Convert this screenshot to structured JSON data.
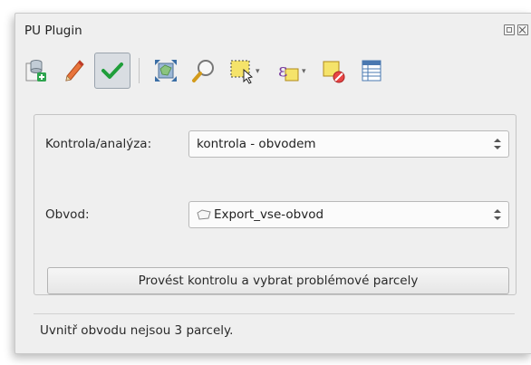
{
  "window": {
    "title": "PU Plugin"
  },
  "toolbar": {
    "tools": [
      {
        "icon": "add-database-layer-icon"
      },
      {
        "icon": "pencil-edit-icon"
      },
      {
        "icon": "checkmark-icon",
        "active": true
      },
      {
        "icon": "zoom-full-extent-icon"
      },
      {
        "icon": "zoom-magnifier-icon"
      },
      {
        "icon": "select-features-icon"
      },
      {
        "icon": "select-by-expression-icon"
      },
      {
        "icon": "deselect-features-icon"
      },
      {
        "icon": "attribute-table-icon"
      }
    ]
  },
  "form": {
    "check_label": "Kontrola/analýza:",
    "check_value": "kontrola - obvodem",
    "perimeter_label": "Obvod:",
    "perimeter_value": "Export_vse-obvod",
    "run_button": "Provést kontrolu a vybrat problémové parcely"
  },
  "status": {
    "text": "Uvnitř obvodu nejsou 3 parcely."
  }
}
